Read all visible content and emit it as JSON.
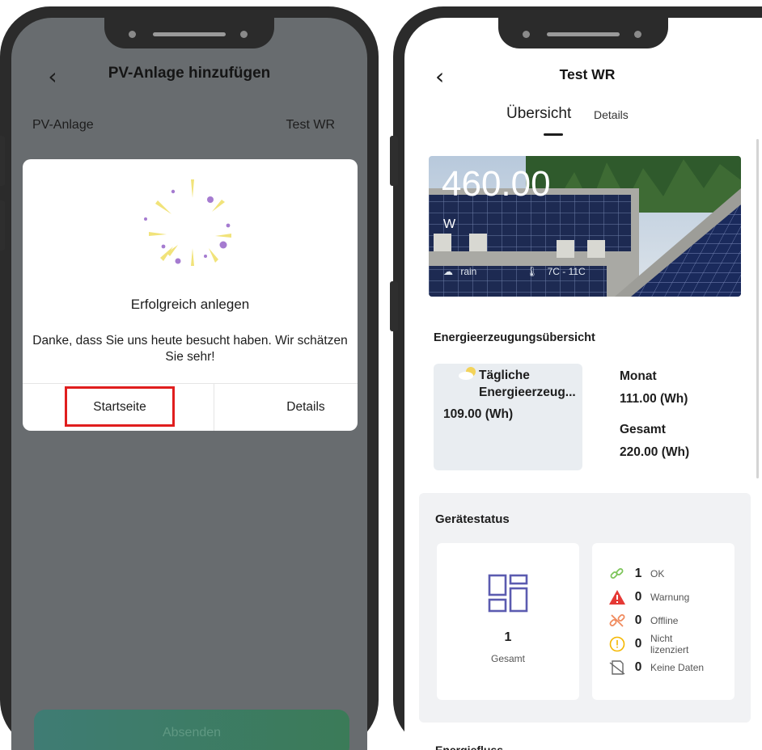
{
  "left_screen": {
    "header": {
      "back_icon": "chevron-left-icon",
      "title": "PV-Anlage hinzufügen"
    },
    "pv_row": {
      "label": "PV-Anlage",
      "value": "Test WR"
    },
    "dialog": {
      "title": "Erfolgreich anlegen",
      "message": "Danke, dass Sie uns heute besucht haben. Wir schätzen Sie sehr!",
      "start_button": "Startseite",
      "details_button": "Details",
      "highlight_color": "#e01e1e"
    },
    "submit_button": "Absenden"
  },
  "right_screen": {
    "header": {
      "back_icon": "chevron-left-icon",
      "title": "Test WR"
    },
    "tabs": [
      {
        "label": "Übersicht",
        "active": true
      },
      {
        "label": "Details",
        "active": false
      }
    ],
    "banner": {
      "power": "460.00",
      "unit": "W",
      "weather": "rain",
      "temperature": "7C - 11C"
    },
    "energy": {
      "title": "Energieerzeugungsübersicht",
      "daily_label": "Tägliche Energieerzeug...",
      "daily_value": "109.00 (Wh)",
      "month_label": "Monat",
      "month_value": "111.00 (Wh)",
      "total_label": "Gesamt",
      "total_value": "220.00 (Wh)"
    },
    "device_status": {
      "title": "Gerätestatus",
      "total_count": "1",
      "total_label": "Gesamt",
      "items": [
        {
          "icon": "link-icon",
          "count": "1",
          "label": "OK",
          "color": "#7dc55a"
        },
        {
          "icon": "warning-icon",
          "count": "0",
          "label": "Warnung",
          "color": "#e53935"
        },
        {
          "icon": "broken-link-icon",
          "count": "0",
          "label": "Offline",
          "color": "#f08a5d"
        },
        {
          "icon": "exclamation-circle-icon",
          "count": "0",
          "label": "Nicht lizenziert",
          "color": "#f5b700"
        },
        {
          "icon": "no-data-icon",
          "count": "0",
          "label": "Keine Daten",
          "color": "#666666"
        }
      ]
    },
    "next_section_peek": "Energiefluss"
  }
}
